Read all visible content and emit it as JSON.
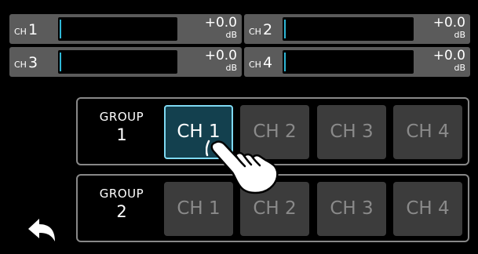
{
  "meters": [
    {
      "prefix": "CH",
      "num": "1",
      "value": "+0.0",
      "unit": "dB"
    },
    {
      "prefix": "CH",
      "num": "2",
      "value": "+0.0",
      "unit": "dB"
    },
    {
      "prefix": "CH",
      "num": "3",
      "value": "+0.0",
      "unit": "dB"
    },
    {
      "prefix": "CH",
      "num": "4",
      "value": "+0.0",
      "unit": "dB"
    }
  ],
  "groups": [
    {
      "title": "GROUP",
      "number": "1",
      "channels": [
        "CH 1",
        "CH 2",
        "CH 3",
        "CH 4"
      ],
      "selected": "CH 1"
    },
    {
      "title": "GROUP",
      "number": "2",
      "channels": [
        "CH 1",
        "CH 2",
        "CH 3",
        "CH 4"
      ],
      "selected": ""
    }
  ],
  "colors": {
    "selected_border": "#7fd9f2",
    "selected_fill": "#13404e",
    "meter_level": "#2fb7d6"
  },
  "icons": {
    "back": "back-arrow-icon",
    "touch": "pointing-hand-icon"
  }
}
